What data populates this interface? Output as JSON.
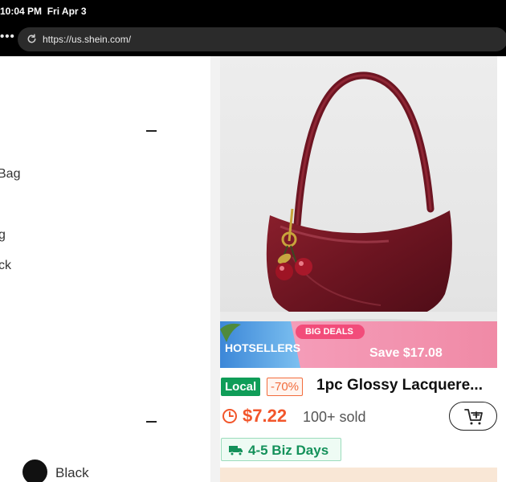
{
  "status_bar": {
    "time": "10:04 PM",
    "date": "Fri Apr 3"
  },
  "browser": {
    "url": "https://us.shein.com/",
    "more_icon": "ellipsis-icon",
    "reload_icon": "reload-icon"
  },
  "filters": {
    "options_partial": [
      "Bag",
      "g",
      "ck"
    ],
    "color_label": "Black",
    "color_hex": "#111111"
  },
  "product": {
    "promo_left": "HOTSELLERS",
    "promo_tag": "BIG DEALS",
    "promo_save": "Save $17.08",
    "badge_local": "Local",
    "badge_discount": "-70%",
    "title": "1pc Glossy Lacquere...",
    "price": "$7.22",
    "sold": "100+ sold",
    "delivery": "4-5 Biz Days",
    "accent_color": "#f2562b",
    "local_color": "#0f9d58"
  }
}
